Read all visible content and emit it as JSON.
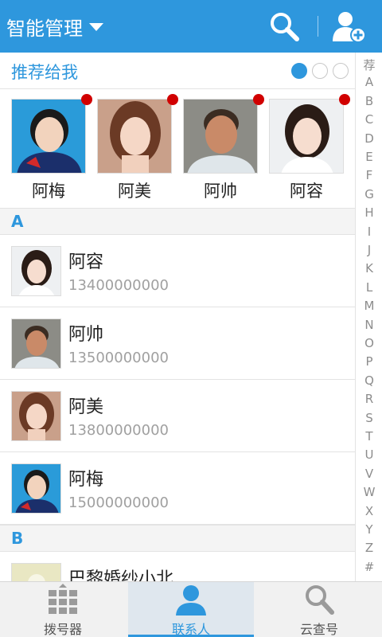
{
  "header": {
    "title": "智能管理",
    "icons": [
      "chevron-down-icon",
      "search-icon",
      "add-user-icon"
    ]
  },
  "recommend": {
    "title": "推荐给我",
    "page_indicator_count": 3,
    "active_page": 1,
    "people": [
      {
        "name": "阿梅",
        "has_badge": true
      },
      {
        "name": "阿美",
        "has_badge": true
      },
      {
        "name": "阿帅",
        "has_badge": true
      },
      {
        "name": "阿容",
        "has_badge": true
      }
    ]
  },
  "sections": [
    {
      "letter": "A",
      "contacts": [
        {
          "name": "阿容",
          "phone": "13400000000"
        },
        {
          "name": "阿帅",
          "phone": "13500000000"
        },
        {
          "name": "阿美",
          "phone": "13800000000"
        },
        {
          "name": "阿梅",
          "phone": "15000000000"
        }
      ]
    },
    {
      "letter": "B",
      "contacts": [
        {
          "name": "巴黎婚纱小北",
          "phone": ""
        }
      ]
    }
  ],
  "alphabet": [
    "荐",
    "A",
    "B",
    "C",
    "D",
    "E",
    "F",
    "G",
    "H",
    "I",
    "J",
    "K",
    "L",
    "M",
    "N",
    "O",
    "P",
    "Q",
    "R",
    "S",
    "T",
    "U",
    "V",
    "W",
    "X",
    "Y",
    "Z",
    "#"
  ],
  "tabs": [
    {
      "label": "拨号器",
      "icon": "dialpad-icon",
      "active": false
    },
    {
      "label": "联系人",
      "icon": "contact-icon",
      "active": true
    },
    {
      "label": "云查号",
      "icon": "search-icon",
      "active": false
    }
  ],
  "colors": {
    "accent": "#2e97dd",
    "badge": "#d10000",
    "secondary_text": "#a0a0a0"
  }
}
